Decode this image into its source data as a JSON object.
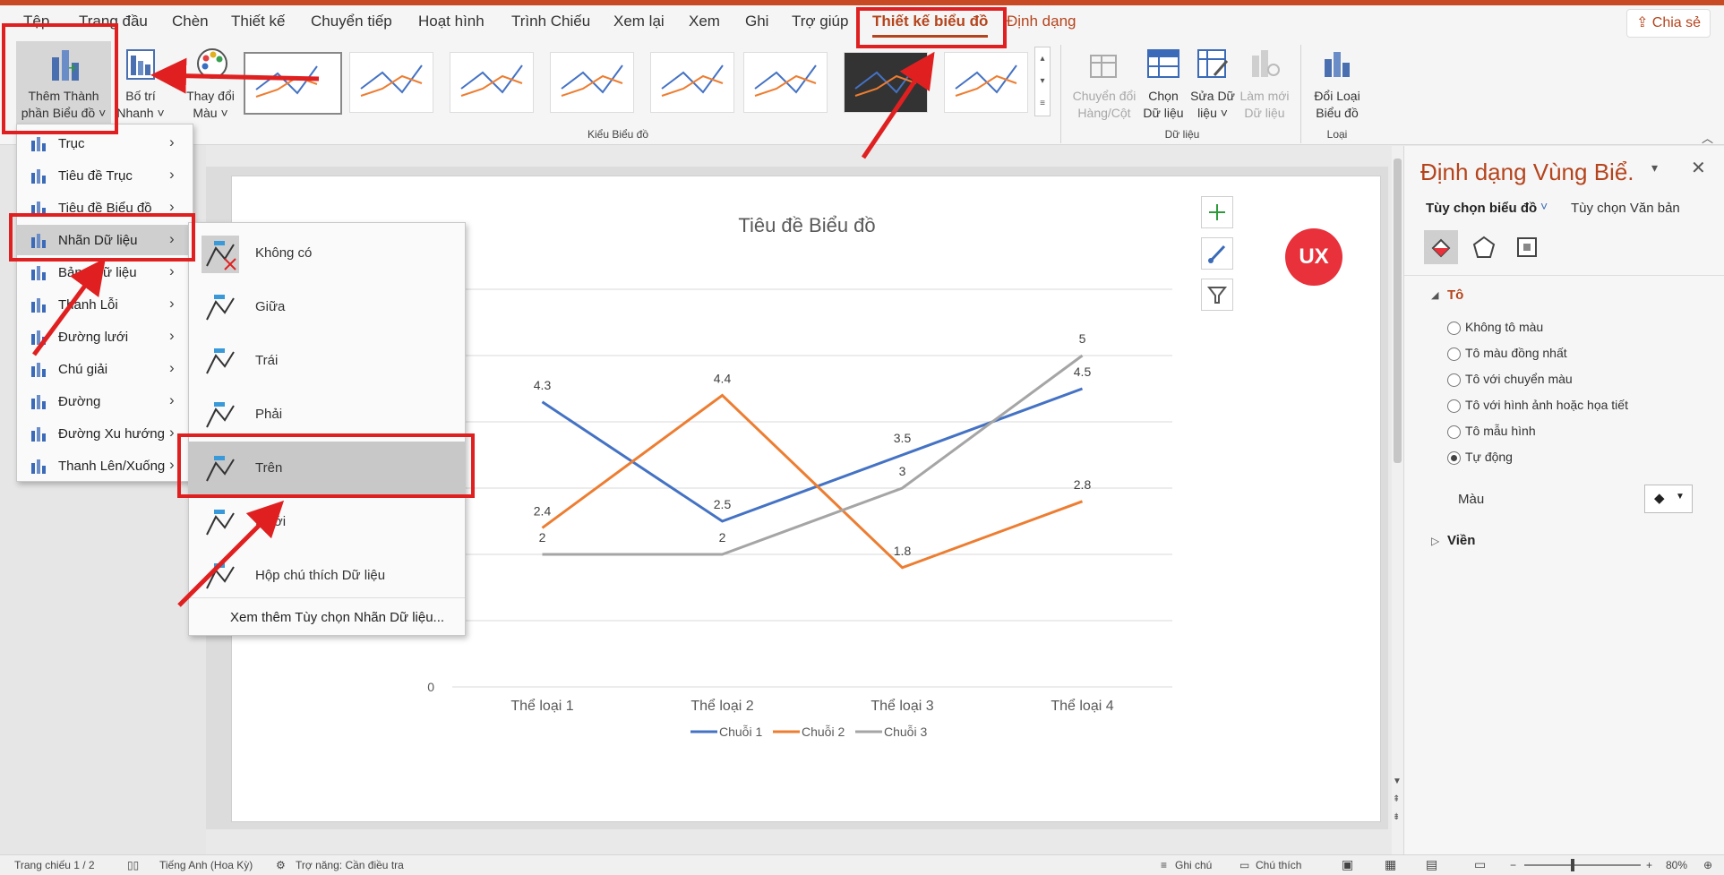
{
  "ribbon": {
    "tabs": [
      "Tệp",
      "Trang đầu",
      "Chèn",
      "Thiết kế",
      "Chuyển tiếp",
      "Hoạt hình",
      "Trình Chiếu",
      "Xem lại",
      "Xem",
      "Ghi",
      "Trợ giúp",
      "Thiết kế biểu đồ",
      "Định dạng"
    ],
    "share_label": "Chia sẻ",
    "add_element": [
      "Thêm Thành",
      "phần Biểu đồ"
    ],
    "quick_layout": [
      "Bố trí",
      "Nhanh"
    ],
    "change_colors": [
      "Thay đổi",
      "Màu"
    ],
    "switch_row_col": [
      "Chuyển đổi",
      "Hàng/Cột"
    ],
    "select_data": [
      "Chọn",
      "Dữ liệu"
    ],
    "edit_data": [
      "Sửa Dữ",
      "liệu"
    ],
    "refresh_data": [
      "Làm mới",
      "Dữ liệu"
    ],
    "change_type": [
      "Đổi Loại",
      "Biểu đồ"
    ],
    "group_styles": "Kiểu Biểu đồ",
    "group_data": "Dữ liệu",
    "group_type": "Loại"
  },
  "menu": {
    "items": [
      "Trục",
      "Tiêu đề Trục",
      "Tiêu đề Biểu đồ",
      "Nhãn Dữ liệu",
      "Bảng Dữ liệu",
      "Thanh Lỗi",
      "Đường lưới",
      "Chú giải",
      "Đường",
      "Đường Xu hướng",
      "Thanh Lên/Xuống"
    ]
  },
  "submenu": {
    "items": [
      "Không có",
      "Giữa",
      "Trái",
      "Phải",
      "Trên",
      "Dưới",
      "Hộp chú thích Dữ liệu"
    ],
    "more": "Xem thêm Tùy chọn Nhãn Dữ liệu..."
  },
  "chart_data": {
    "type": "line",
    "title": "Tiêu đề Biểu đồ",
    "categories": [
      "Thể loại 1",
      "Thể loại 2",
      "Thể loại 3",
      "Thể loại 4"
    ],
    "series": [
      {
        "name": "Chuỗi 1",
        "values": [
          4.3,
          2.5,
          3.5,
          4.5
        ],
        "color": "#4472c4"
      },
      {
        "name": "Chuỗi 2",
        "values": [
          2.4,
          4.4,
          1.8,
          2.8
        ],
        "color": "#ed7d31"
      },
      {
        "name": "Chuỗi 3",
        "values": [
          2,
          2,
          3,
          5
        ],
        "color": "#a5a5a5"
      }
    ],
    "ylim": [
      0,
      6
    ],
    "visible_ytick": "0",
    "data_labels": "above",
    "grid": true,
    "legend": "bottom"
  },
  "logo": "UX",
  "pane": {
    "title": "Định dạng Vùng Biể.",
    "tab1": "Tùy chọn biểu đồ",
    "tab2": "Tùy chọn Văn bản",
    "fill_section": "Tô",
    "fill_options": [
      "Không tô màu",
      "Tô màu đồng nhất",
      "Tô với chuyển màu",
      "Tô với hình ảnh hoặc họa tiết",
      "Tô mẫu hình",
      "Tự động"
    ],
    "selected_fill": 5,
    "color_label": "Màu",
    "border_section": "Viền"
  },
  "status": {
    "slide": "Trang chiếu 1 / 2",
    "lang": "Tiếng Anh (Hoa Kỳ)",
    "access": "Trợ năng: Cần điều tra",
    "notes": "Ghi chú",
    "comments": "Chú thích",
    "zoom": "80%"
  },
  "colors": {
    "accent": "#b5441c",
    "annotation": "#e02020"
  }
}
